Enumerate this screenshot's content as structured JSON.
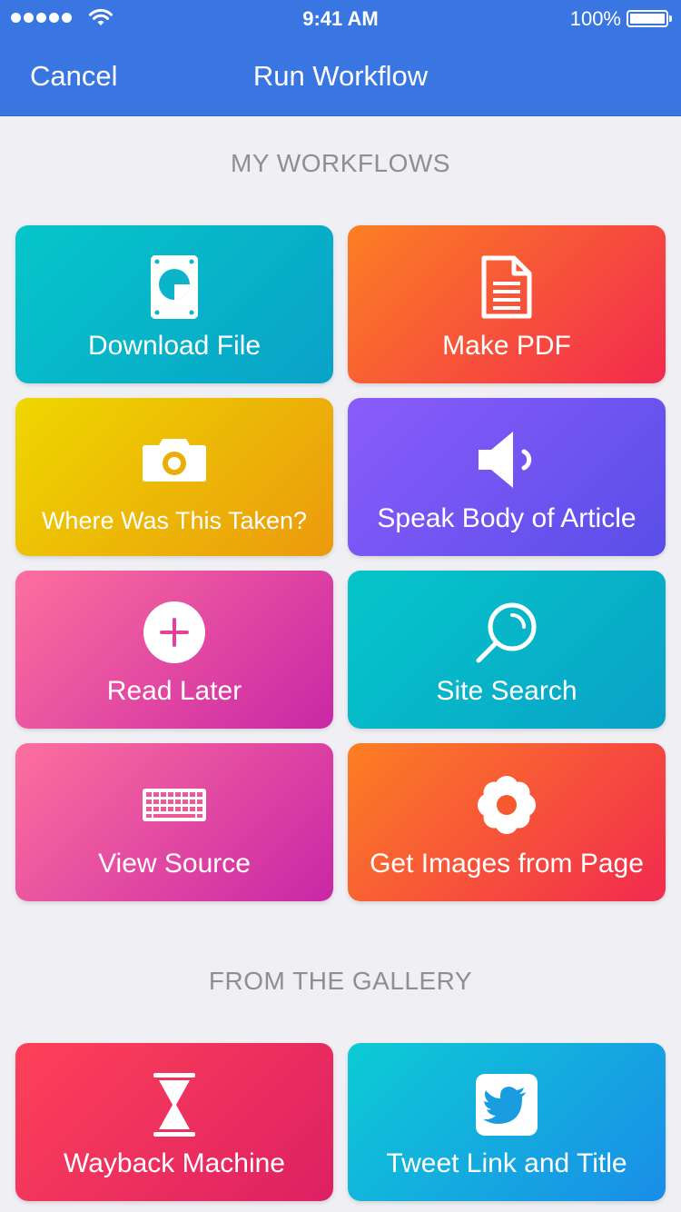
{
  "status_bar": {
    "time": "9:41 AM",
    "battery": "100%"
  },
  "nav": {
    "cancel_label": "Cancel",
    "title": "Run Workflow"
  },
  "sections": {
    "my_workflows": "MY WORKFLOWS",
    "from_gallery": "FROM THE GALLERY"
  },
  "workflows": [
    {
      "label": "Download File",
      "icon": "hard-drive-icon",
      "color": "#05c6c9"
    },
    {
      "label": "Make PDF",
      "icon": "document-icon",
      "color": "#fc7f23"
    },
    {
      "label": "Where Was This Taken?",
      "icon": "camera-icon",
      "color": "#eed700"
    },
    {
      "label": "Speak Body of Article",
      "icon": "speaker-icon",
      "color": "#8a5cfb"
    },
    {
      "label": "Read Later",
      "icon": "plus-circle-icon",
      "color": "#fe6f9d"
    },
    {
      "label": "Site Search",
      "icon": "magnifier-icon",
      "color": "#05c6c9"
    },
    {
      "label": "View Source",
      "icon": "keyboard-icon",
      "color": "#fe6f9d"
    },
    {
      "label": "Get Images from Page",
      "icon": "flower-icon",
      "color": "#fc7f23"
    }
  ],
  "gallery": [
    {
      "label": "Wayback Machine",
      "icon": "hourglass-icon",
      "color": "#fe4158"
    },
    {
      "label": "Tweet Link and Title",
      "icon": "twitter-icon",
      "color": "#0dcbd5"
    }
  ]
}
